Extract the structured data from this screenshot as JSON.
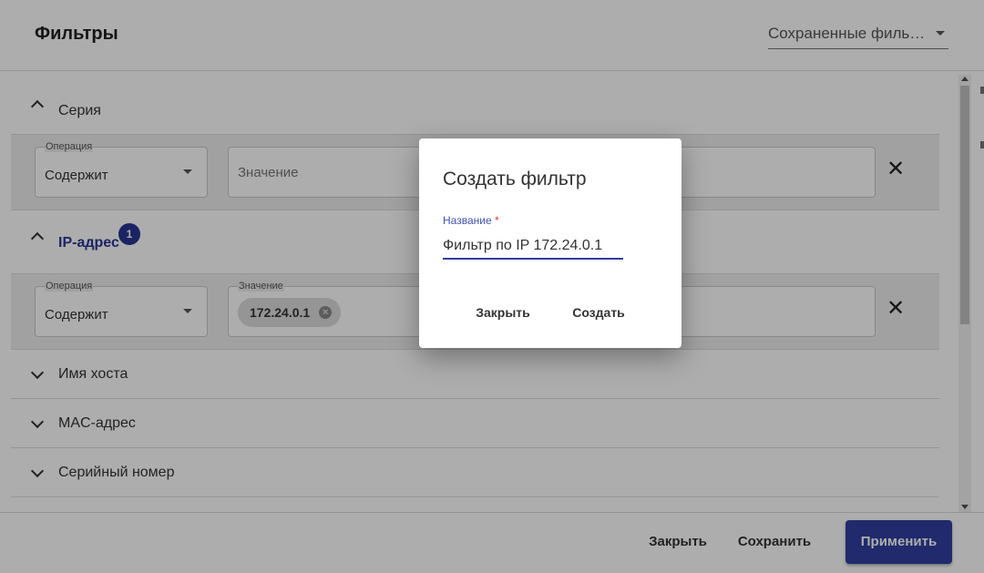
{
  "header": {
    "title": "Фильтры",
    "saved_filters": {
      "value": "Сохраненные филь…"
    }
  },
  "sections": [
    {
      "label": "Серия",
      "expanded": true,
      "operation_label": "Операция",
      "operation_value": "Содержит",
      "value_placeholder": "Значение"
    },
    {
      "label": "IP-адрес",
      "expanded": true,
      "badge": "1",
      "operation_label": "Операция",
      "operation_value": "Содержит",
      "value_label": "Значение",
      "chip": "172.24.0.1"
    },
    {
      "label": "Имя хоста",
      "expanded": false
    },
    {
      "label": "MAC-адрес",
      "expanded": false
    },
    {
      "label": "Серийный номер",
      "expanded": false
    }
  ],
  "footer": {
    "close_label": "Закрыть",
    "save_label": "Сохранить",
    "apply_label": "Применить"
  },
  "dialog": {
    "title": "Создать фильтр",
    "name_label": "Название",
    "required_mark": "*",
    "name_value": "Фильтр по IP 172.24.0.1",
    "close_label": "Закрыть",
    "create_label": "Создать"
  },
  "colors": {
    "primary": "#303f9f",
    "badge": "#283593",
    "required": "#e53935"
  },
  "icons": {
    "remove": "✕",
    "chip_remove": "×"
  }
}
